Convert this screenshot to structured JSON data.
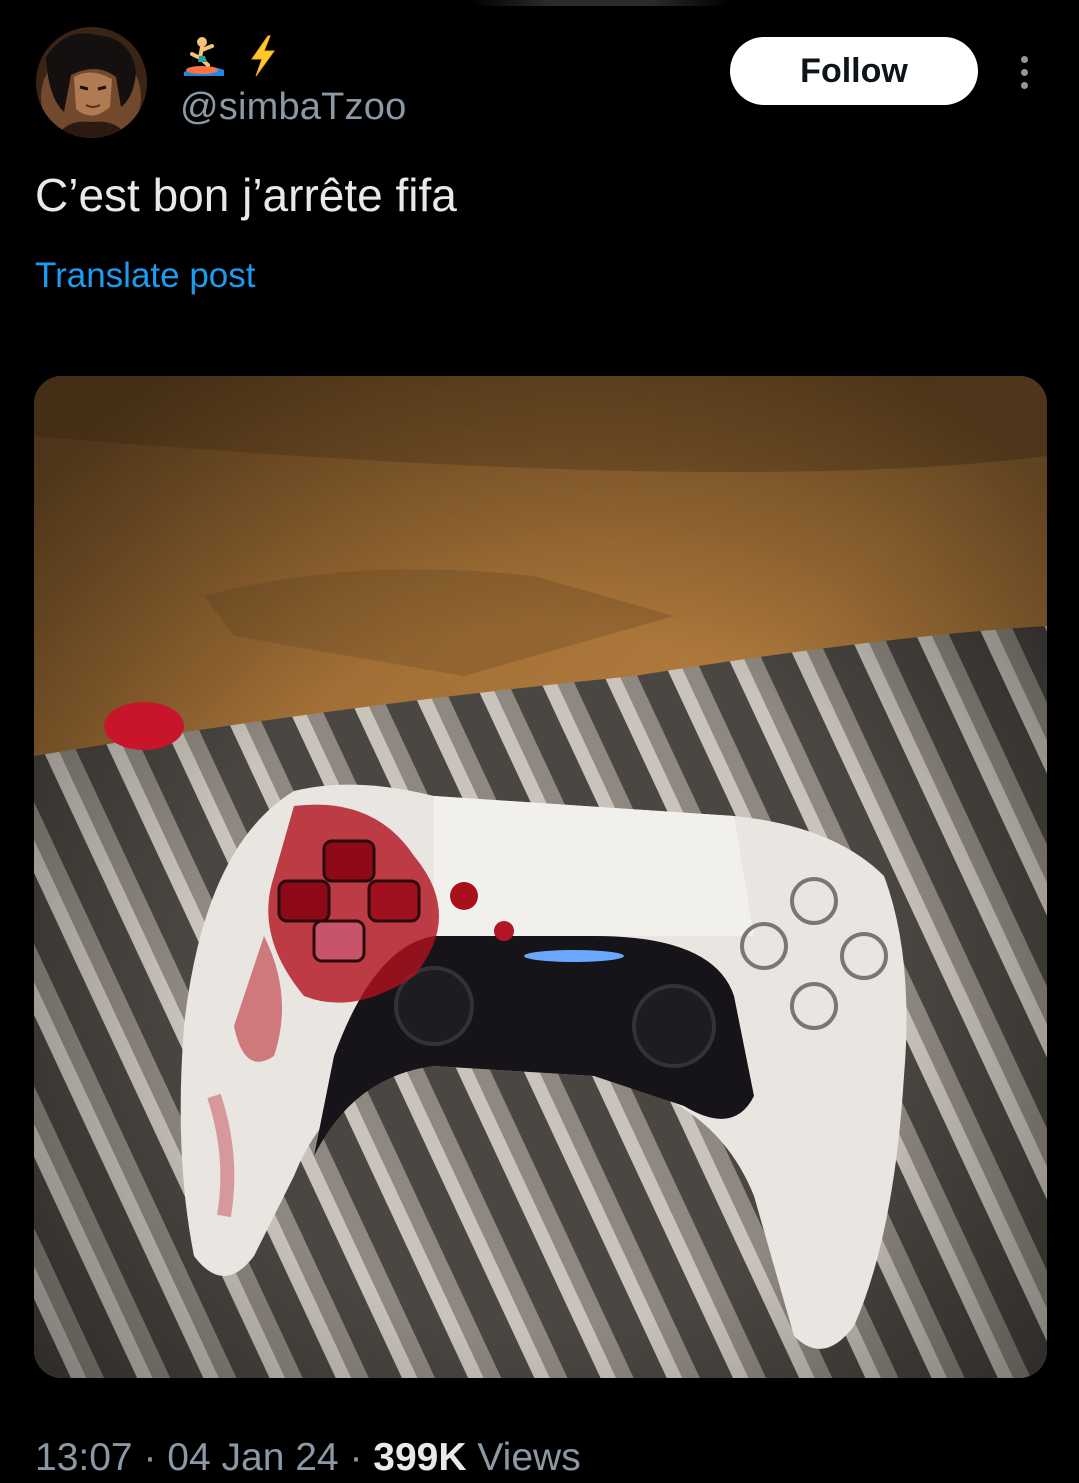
{
  "author": {
    "handle": "@simbaTzoo",
    "display_name_emojis": [
      "surfer-emoji",
      "lightning-emoji"
    ]
  },
  "actions": {
    "follow_label": "Follow"
  },
  "post": {
    "text": "C’est bon j’arrête fifa",
    "translate_label": "Translate post",
    "media_description_icon": "photo"
  },
  "meta": {
    "time": "13:07",
    "separator": "·",
    "date": "04 Jan 24",
    "views_count": "399K",
    "views_label": "Views"
  },
  "colors": {
    "background": "#000000",
    "text_primary": "#e7e9ea",
    "text_secondary": "#8b98a5",
    "link": "#1d9bf0",
    "follow_button_bg": "#ffffff"
  }
}
